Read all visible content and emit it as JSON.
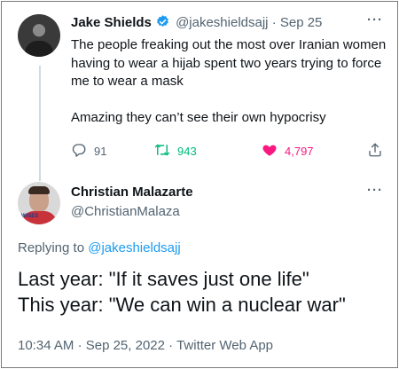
{
  "original_tweet": {
    "display_name": "Jake Shields",
    "handle": "@jakeshieldsajj",
    "separator": "·",
    "date": "Sep 25",
    "text_paragraph_1": "The people freaking out the most over Iranian women having to wear a hijab spent two years trying to force me to wear a mask",
    "text_paragraph_2": "Amazing they can’t see their own hypocrisy",
    "more_label": "···",
    "stats": {
      "replies": "91",
      "retweets": "943",
      "likes": "4,797"
    }
  },
  "reply_tweet": {
    "display_name": "Christian Malazarte",
    "handle": "@ChristianMalaza",
    "more_label": "···",
    "avatar_text": "WISES",
    "replying_prefix": "Replying to",
    "replying_to": "@jakeshieldsajj",
    "text_line_1": "Last year: \"If it saves just one life\"",
    "text_line_2": "This year: \"We can win a nuclear war\"",
    "time": "10:34 AM",
    "separator": "·",
    "date": "Sep 25, 2022",
    "source": "Twitter Web App"
  },
  "colors": {
    "text_primary": "#0f1419",
    "text_secondary": "#536471",
    "link": "#1d9bf0",
    "retweet": "#00ba7c",
    "like": "#f91880",
    "verified": "#1d9bf0"
  },
  "icons": {
    "verified": "verified-badge-icon",
    "reply": "reply-bubble-icon",
    "retweet": "retweet-arrows-icon",
    "like": "heart-filled-icon",
    "share": "share-upload-icon",
    "more": "more-dots-icon"
  }
}
